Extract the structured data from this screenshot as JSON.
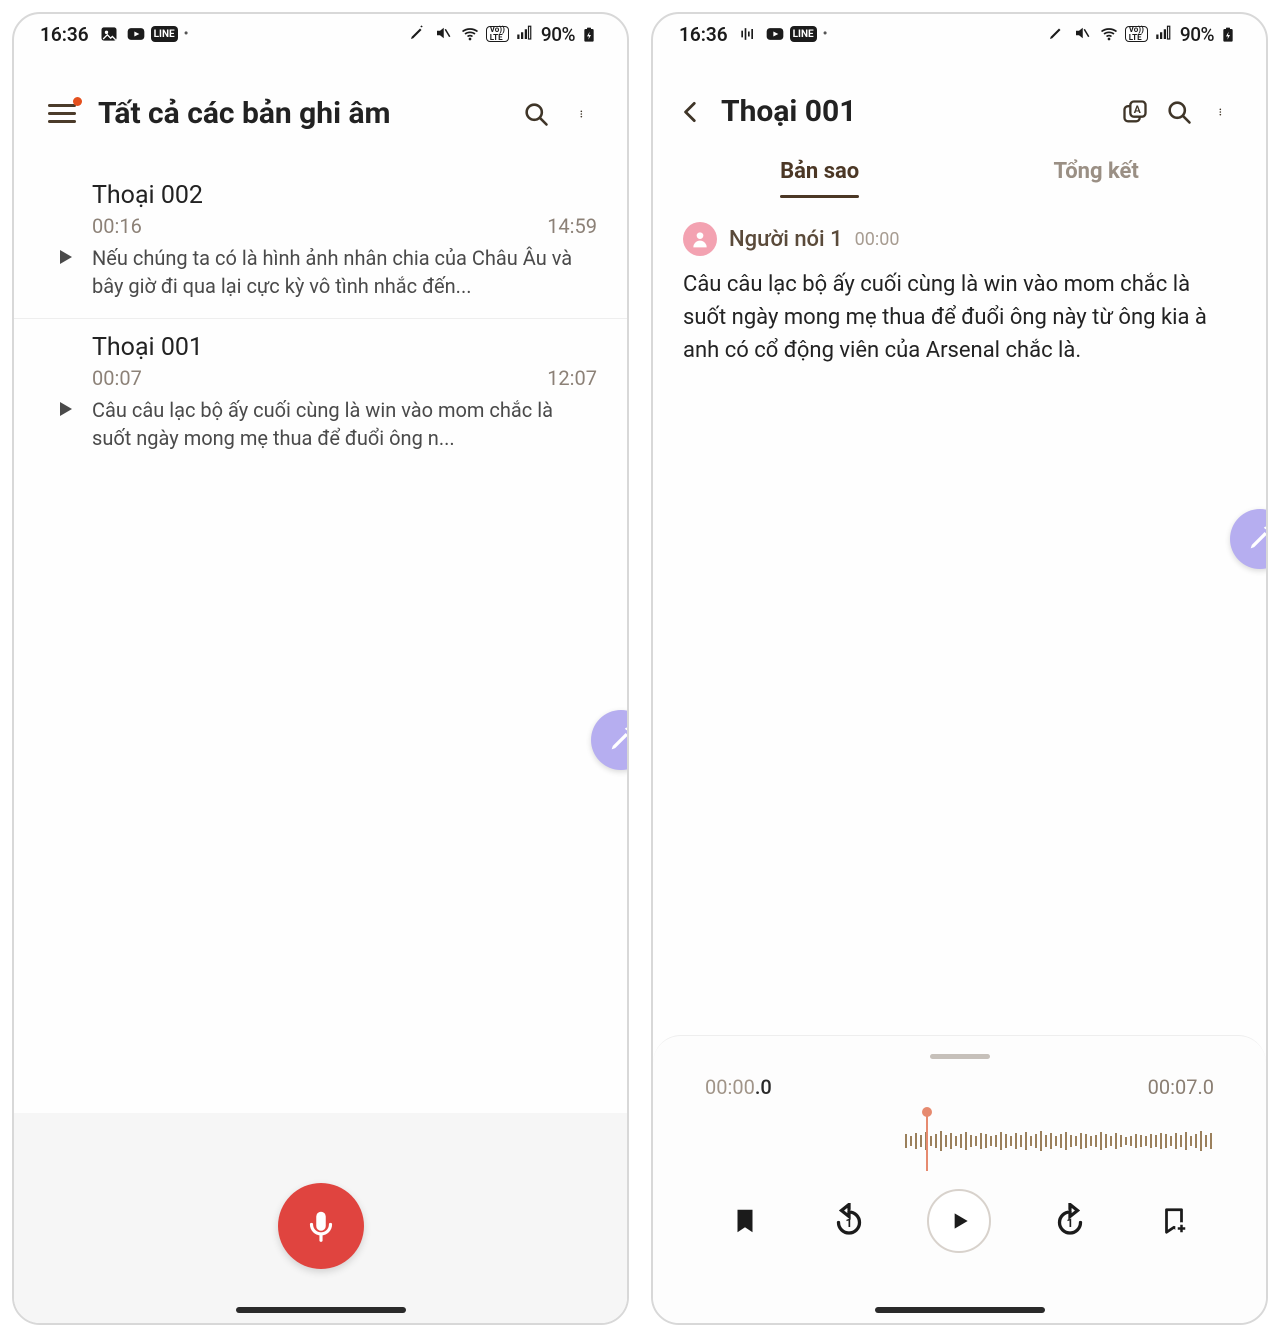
{
  "left": {
    "status": {
      "time": "16:36",
      "battery": "90%"
    },
    "header": {
      "title": "Tất cả các bản ghi âm"
    },
    "recordings": [
      {
        "title": "Thoại 002",
        "duration": "00:16",
        "time": "14:59",
        "preview": "Nếu chúng ta có là hình ảnh nhân chia của Châu Âu và bây giờ đi qua lại cực kỳ vô tình nhắc đến..."
      },
      {
        "title": "Thoại 001",
        "duration": "00:07",
        "time": "12:07",
        "preview": "Câu câu lạc bộ ấy cuối cùng là win vào mom chắc là suốt ngày mong mẹ thua để đuổi ông n..."
      }
    ]
  },
  "right": {
    "status": {
      "time": "16:36",
      "battery": "90%"
    },
    "header": {
      "title": "Thoại 001"
    },
    "tabs": {
      "transcript": "Bản sao",
      "summary": "Tổng kết"
    },
    "speaker": {
      "name": "Người nói 1",
      "time": "00:00"
    },
    "transcript_text": "Câu câu lạc bộ ấy cuối cùng là win vào mom chắc là suốt ngày mong mẹ thua để đuổi ông này từ ông kia à anh có cổ động viên của Arsenal chắc là.",
    "player": {
      "current_main": "00:00",
      "current_frac": ".0",
      "total": "00:07.0"
    },
    "vo_lte": "Vo))\nLTE"
  }
}
